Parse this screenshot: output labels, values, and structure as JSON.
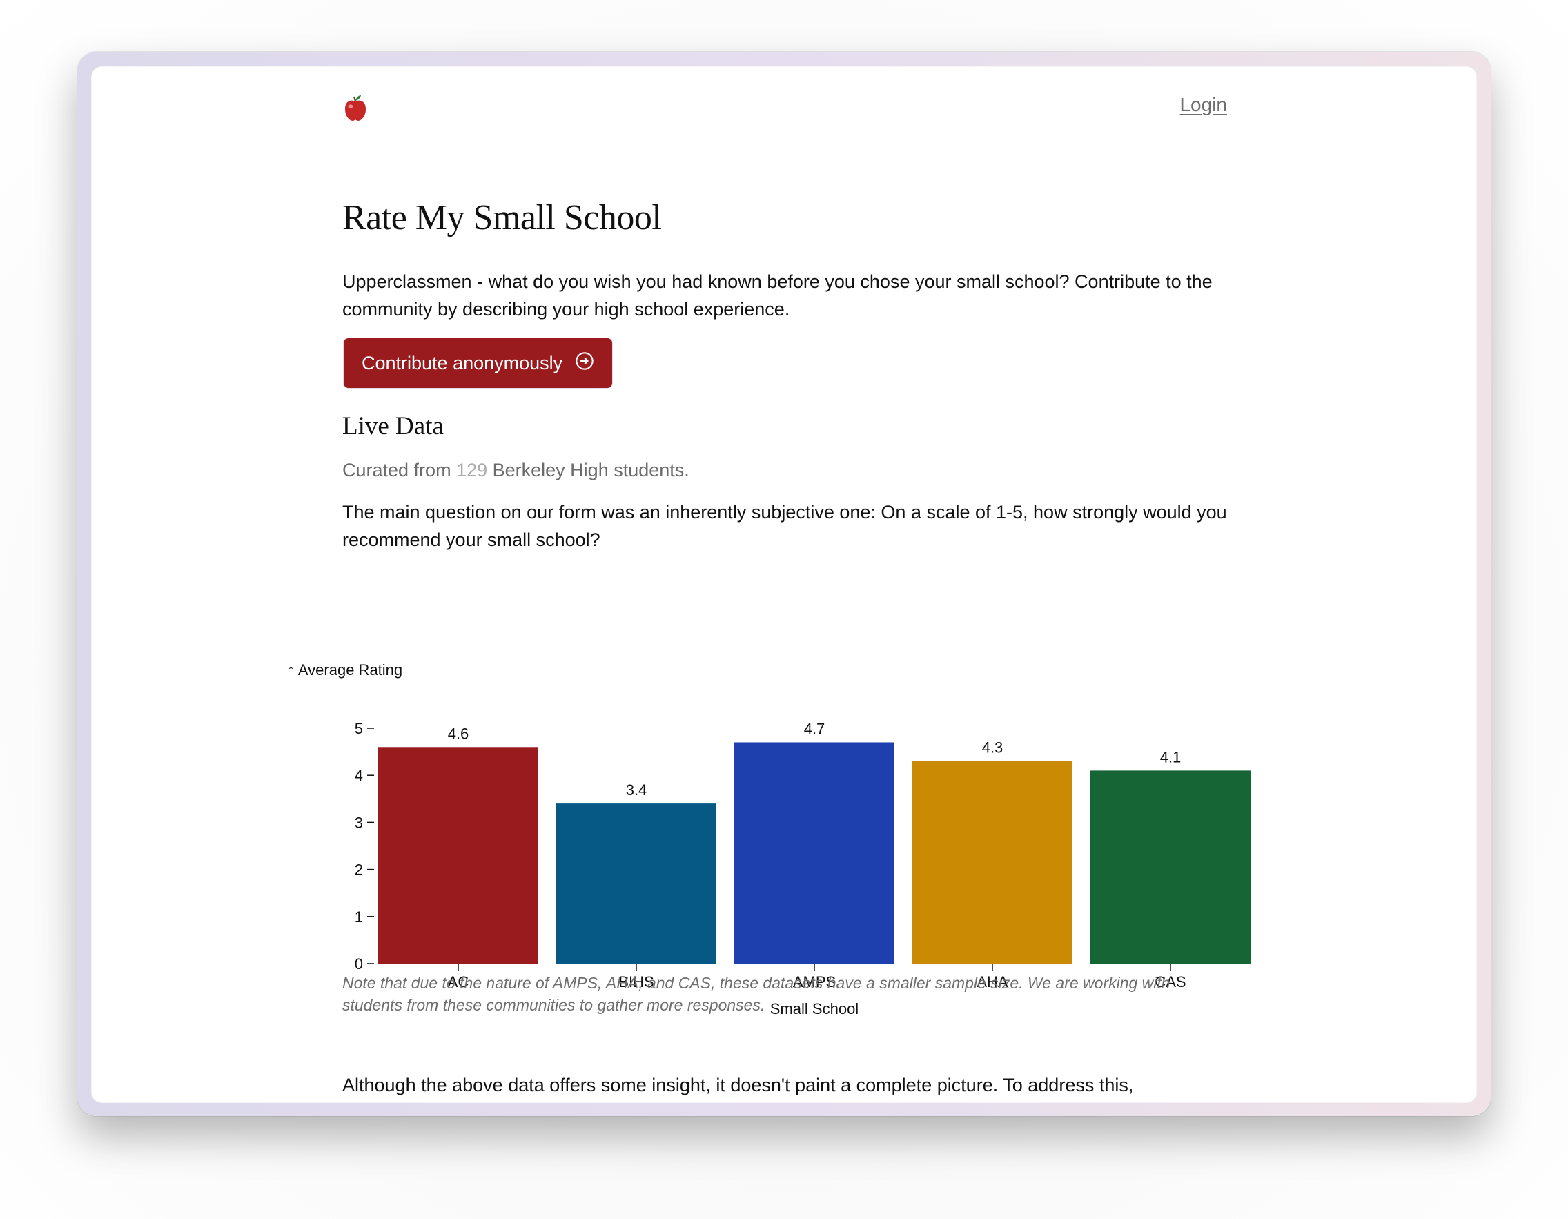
{
  "header": {
    "logo_icon": "apple-icon",
    "login_label": "Login"
  },
  "hero": {
    "title": "Rate My Small School",
    "intro": "Upperclassmen - what do you wish you had known before you chose your small school? Contribute to the community by describing your high school experience.",
    "cta_label": "Contribute anonymously",
    "cta_icon": "arrow-circle-right-icon",
    "cta_color": "#991b1e"
  },
  "live_data": {
    "heading": "Live Data",
    "curated_prefix": "Curated from ",
    "curated_count": "129",
    "curated_suffix": " Berkeley High students.",
    "question": "The main question on our form was an inherently subjective one: On a scale of 1-5, how strongly would you recommend your small school?",
    "note": "Note that due to the nature of AMPS, AHA, and CAS, these datasets have a smaller sample size. We are working with students from these communities to gather more responses.",
    "closing": "Although the above data offers some insight, it doesn't paint a complete picture. To address this,"
  },
  "chart_data": {
    "type": "bar",
    "title": "",
    "xlabel": "Small School",
    "ylabel": "↑ Average Rating",
    "categories": [
      "AC",
      "BIHS",
      "AMPS",
      "AHA",
      "CAS"
    ],
    "values": [
      4.6,
      3.4,
      4.7,
      4.3,
      4.1
    ],
    "value_labels": [
      "4.6",
      "3.4",
      "4.7",
      "4.3",
      "4.1"
    ],
    "colors": [
      "#991b1e",
      "#065985",
      "#1e40af",
      "#ca8a04",
      "#166534"
    ],
    "ylim": [
      0,
      5
    ],
    "yticks": [
      0,
      1,
      2,
      3,
      4,
      5
    ],
    "grid": false,
    "legend": "none"
  }
}
